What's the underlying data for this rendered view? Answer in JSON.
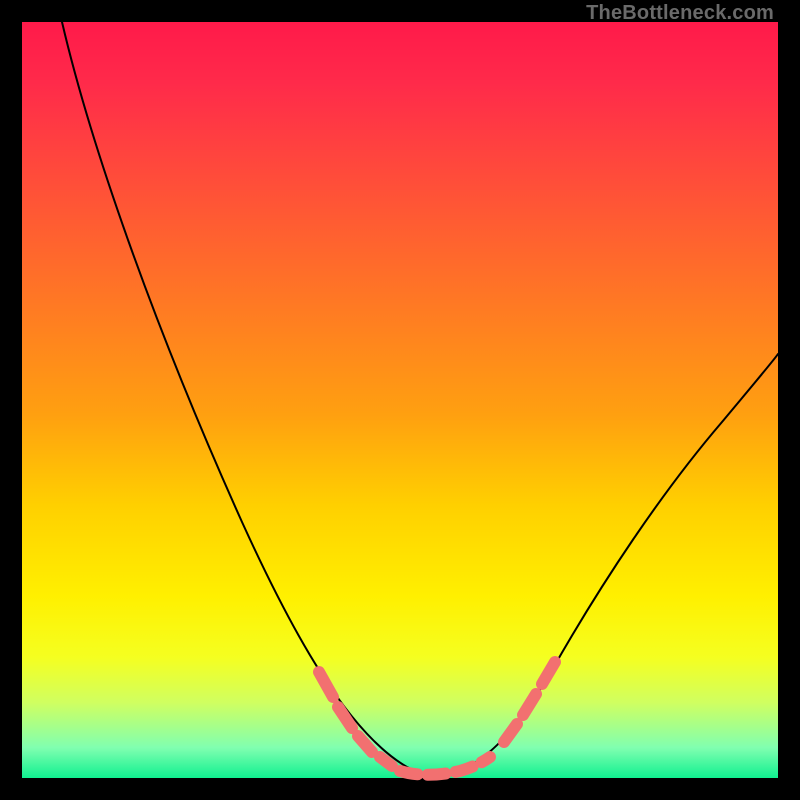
{
  "watermark": "TheBottleneck.com",
  "colors": {
    "background": "#000000",
    "gradient_top": "#ff1a4a",
    "gradient_bottom": "#10f090",
    "curve": "#000000",
    "highlight": "#f27070"
  },
  "chart_data": {
    "type": "line",
    "title": "",
    "xlabel": "",
    "ylabel": "",
    "xlim": [
      0,
      100
    ],
    "ylim": [
      0,
      100
    ],
    "series": [
      {
        "name": "bottleneck-curve",
        "x": [
          5,
          10,
          15,
          20,
          25,
          30,
          35,
          40,
          45,
          50,
          52,
          55,
          57,
          60,
          65,
          70,
          75,
          80,
          85,
          90,
          95,
          100
        ],
        "values": [
          100,
          90,
          80,
          70,
          59,
          48,
          37,
          24,
          12,
          3,
          1,
          0,
          0,
          1,
          4,
          10,
          18,
          27,
          37,
          47,
          55,
          60
        ]
      }
    ],
    "highlights": [
      {
        "name": "left-arm-dash",
        "x_start": 40,
        "x_end": 50,
        "style": "dashed"
      },
      {
        "name": "valley-solid",
        "x_start": 50,
        "x_end": 60,
        "style": "solid-dash"
      },
      {
        "name": "right-arm-dash",
        "x_start": 62,
        "x_end": 70,
        "style": "dashed"
      }
    ],
    "annotations": []
  }
}
